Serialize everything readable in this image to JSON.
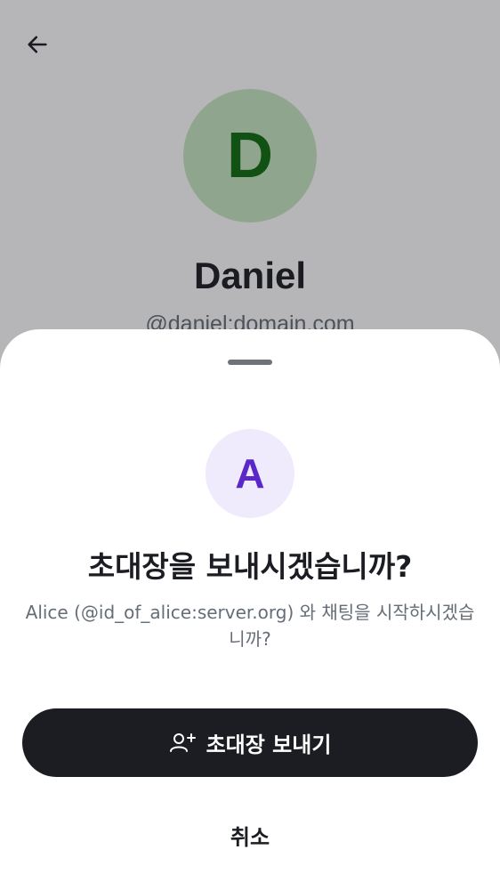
{
  "background": {
    "back_icon": "arrow-left-icon",
    "avatar_initial": "D",
    "avatar_bg": "#c8e6c1",
    "avatar_fg": "#0d6b0d",
    "name": "Daniel",
    "handle": "@daniel:domain.com"
  },
  "sheet": {
    "avatar_initial": "A",
    "avatar_bg": "#efebfd",
    "avatar_fg": "#5a27c8",
    "title": "초대장을 보내시겠습니까?",
    "message": "Alice (@id_of_alice:server.org) 와 채팅을 시작하시겠습니까?",
    "send_invite_icon": "user-add-icon",
    "send_invite_label": "초대장 보내기",
    "cancel_label": "취소"
  },
  "colors": {
    "primary_button": "#1b1d22",
    "secondary_text": "#656d77",
    "scrim": "rgba(27,29,34,0.32)"
  }
}
